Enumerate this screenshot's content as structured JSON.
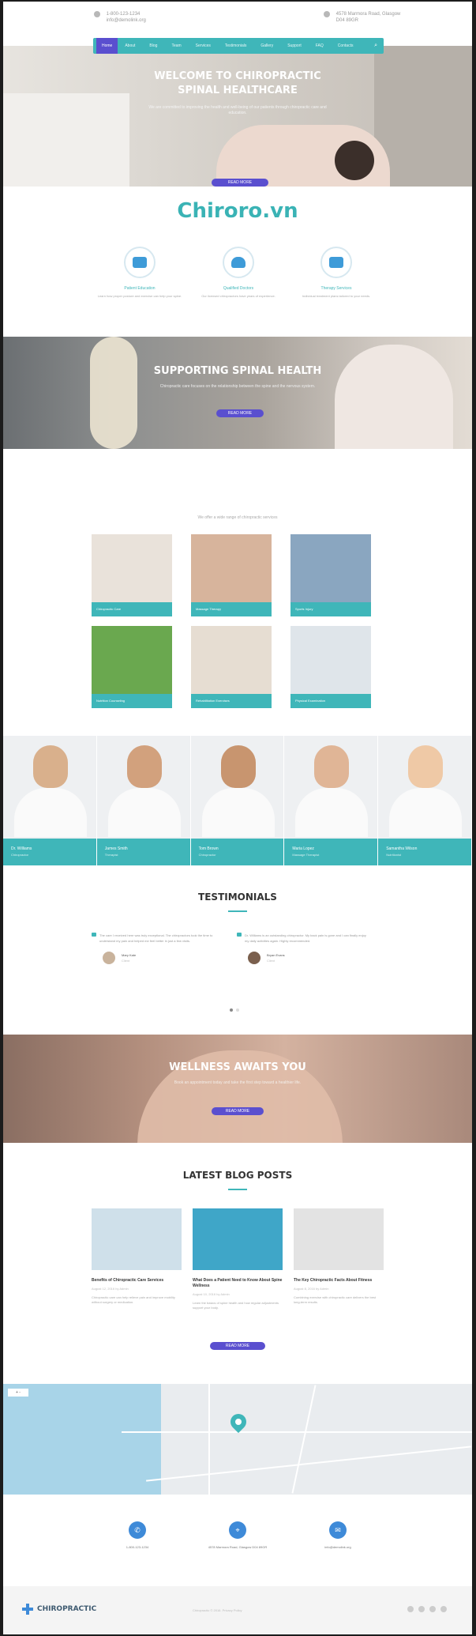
{
  "topbar": {
    "phone_line1": "1-800-123-1234",
    "phone_line2": "info@demolink.org",
    "address_line1": "4578 Marmora Road, Glasgow",
    "address_line2": "D04 89GR"
  },
  "nav": {
    "items": [
      "Home",
      "About",
      "Blog",
      "Team",
      "Services",
      "Testimonials",
      "Gallery",
      "Support",
      "FAQ",
      "Contacts"
    ],
    "search_icon": "search-icon"
  },
  "hero": {
    "title_line1": "WELCOME TO CHIROPRACTIC",
    "title_line2": "SPINAL HEALTHCARE",
    "text": "We are committed to improving the health and well-being of our patients through chiropractic care and education.",
    "button": "READ MORE"
  },
  "brand": "Chiroro.vn",
  "features": [
    {
      "icon": "consultation-icon",
      "title": "Patient Education",
      "text": "Learn how proper posture and exercise can help your spine."
    },
    {
      "icon": "doctor-icon",
      "title": "Qualified Doctors",
      "text": "Our licensed chiropractors have years of experience."
    },
    {
      "icon": "therapy-icon",
      "title": "Therapy Services",
      "text": "Individual treatment plans tailored to your needs."
    }
  ],
  "banner2": {
    "title": "SUPPORTING SPINAL HEALTH",
    "text": "Chiropractic care focuses on the relationship between the spine and the nervous system.",
    "button": "READ MORE"
  },
  "services_intro": "We offer a wide range of chiropractic services",
  "services": [
    {
      "label": "Chiropractic Care",
      "color": "#e9e2da"
    },
    {
      "label": "Massage Therapy",
      "color": "#d7b49c"
    },
    {
      "label": "Sports Injury",
      "color": "#8aa6c0"
    },
    {
      "label": "Nutrition Counseling",
      "color": "#6aa84f"
    },
    {
      "label": "Rehabilitation Exercises",
      "color": "#e6ddd2"
    },
    {
      "label": "Physical Examination",
      "color": "#dfe5ea"
    }
  ],
  "doctors": [
    {
      "name": "Dr. Williams",
      "role": "Chiropractor",
      "head": "#d9b08c"
    },
    {
      "name": "James Smith",
      "role": "Therapist",
      "head": "#d2a17d"
    },
    {
      "name": "Tom Brown",
      "role": "Chiropractor",
      "head": "#c8956f"
    },
    {
      "name": "Maria Lopez",
      "role": "Massage Therapist",
      "head": "#e0b596"
    },
    {
      "name": "Samantha Wilson",
      "role": "Nutritionist",
      "head": "#efc9a6"
    }
  ],
  "testimonials": {
    "title": "TESTIMONIALS",
    "items": [
      {
        "quote": "The care I received here was truly exceptional. The chiropractors took the time to understand my pain and helped me feel better in just a few visits.",
        "name": "Mary Kate",
        "role": "Client"
      },
      {
        "quote": "Dr. Williams is an outstanding chiropractor. My back pain is gone and I can finally enjoy my daily activities again. Highly recommended.",
        "name": "Bryan Evans",
        "role": "Client"
      }
    ]
  },
  "banner3": {
    "title": "WELLNESS AWAITS YOU",
    "text": "Book an appointment today and take the first step toward a healthier life.",
    "button": "READ MORE"
  },
  "blog": {
    "title": "LATEST BLOG POSTS",
    "posts": [
      {
        "title": "Benefits of Chiropractic Care Services",
        "meta": "August 12, 2016 by Admin",
        "excerpt": "Chiropractic care can help relieve pain and improve mobility without surgery or medication.",
        "color": "#cfe0ea"
      },
      {
        "title": "What Does a Patient Need to Know About Spine Wellness",
        "meta": "August 10, 2016 by Admin",
        "excerpt": "Learn the basics of spine health and how regular adjustments support your body.",
        "color": "#3fa6c8"
      },
      {
        "title": "The Key Chiropractic Facts About Fitness",
        "meta": "August 8, 2016 by Admin",
        "excerpt": "Combining exercise with chiropractic care delivers the best long-term results.",
        "color": "#e3e3e3"
      }
    ],
    "button": "READ MORE"
  },
  "map": {
    "zoom_label": "+ -"
  },
  "contacts": [
    {
      "icon": "phone-icon",
      "glyph": "✆",
      "text": "1-800-123-1234"
    },
    {
      "icon": "location-icon",
      "glyph": "⌖",
      "text": "4578 Marmora Road, Glasgow D04 89GR"
    },
    {
      "icon": "email-icon",
      "glyph": "✉",
      "text": "info@demolink.org"
    }
  ],
  "footer": {
    "logo": "CHIROPRACTIC",
    "copyright": "Chiropractic © 2016. Privacy Policy",
    "social": [
      "facebook-icon",
      "twitter-icon",
      "google-icon",
      "instagram-icon"
    ]
  }
}
